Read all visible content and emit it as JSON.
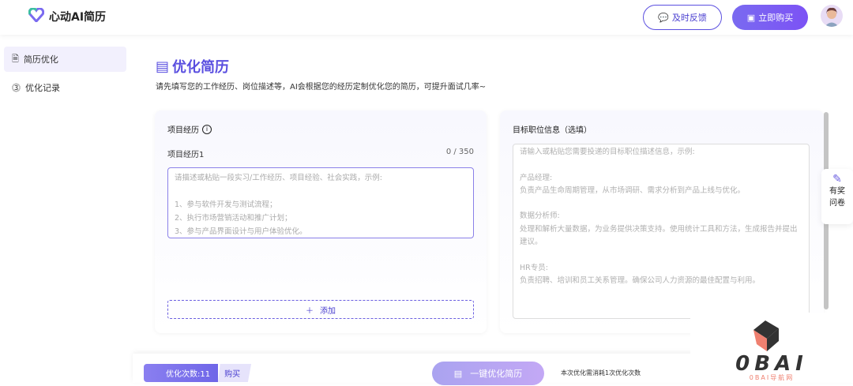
{
  "header": {
    "brand": "心动AI简历",
    "feedback_label": "及时反馈",
    "buy_label": "立即购买"
  },
  "sidebar": {
    "items": [
      {
        "label": "简历优化",
        "active": true
      },
      {
        "label": "优化记录",
        "active": false
      }
    ]
  },
  "main": {
    "title": "优化简历",
    "subtitle": "请先填写您的工作经历、岗位描述等，AI会根据您的经历定制优化您的简历，可提升面试几率~",
    "project": {
      "title": "项目经历",
      "item_label": "项目经历1",
      "count": "0 / 350",
      "placeholder": "请描述或粘贴一段实习/工作经历、项目经验、社会实践，示例:\n\n1、参与软件开发与测试流程；\n2、执行市场营销活动和推广计划；\n3、参与产品界面设计与用户体验优化。",
      "add_label": "添加"
    },
    "target": {
      "title": "目标职位信息（选填）",
      "placeholder": "请输入或粘贴您需要投递的目标职位描述信息，示例:\n\n产品经理:\n负责产品生命周期管理，从市场调研、需求分析到产品上线与优化。\n\n数据分析师:\n处理和解析大量数据，为业务提供决策支持。使用统计工具和方法，生成报告并提出建议。\n\nHR专员:\n负责招聘、培训和员工关系管理。确保公司人力资源的最佳配置与利用。"
    }
  },
  "survey": {
    "label_1": "有奖",
    "label_2": "问卷"
  },
  "bottom": {
    "quota_label": "优化次数:11",
    "buy_label": "购买",
    "optimize_label": "一键优化简历",
    "note": "本次优化需消耗1次优化次数"
  },
  "watermark": {
    "logo_text": "0BAI",
    "sub_text": "0BAI导航网"
  },
  "colors": {
    "accent": "#5a4fe0",
    "button_gradient": "#7c52f5"
  }
}
